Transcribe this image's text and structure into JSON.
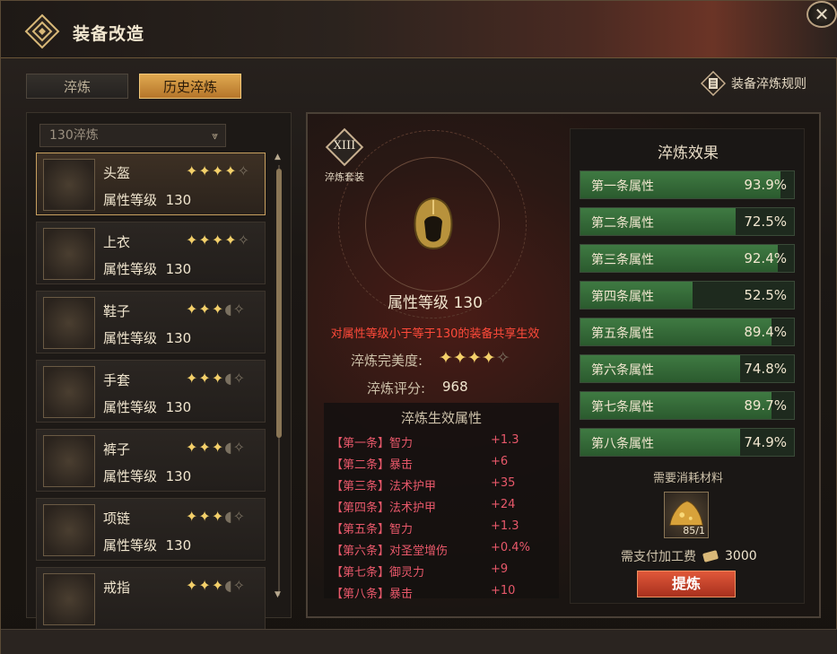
{
  "window": {
    "title": "装备改造"
  },
  "tabs": [
    {
      "label": "淬炼"
    },
    {
      "label": "历史淬炼"
    }
  ],
  "rules_link": {
    "label": "装备淬炼规则"
  },
  "filter": {
    "selected": "130淬炼"
  },
  "equipment_list": [
    {
      "name": "头盔",
      "level_label": "属性等级",
      "level": "130",
      "stars": "✦✦✦✦",
      "stars_dim": "✧",
      "icon": "helmet-icon"
    },
    {
      "name": "上衣",
      "level_label": "属性等级",
      "level": "130",
      "stars": "✦✦✦✦",
      "stars_dim": "✧",
      "icon": "armor-icon"
    },
    {
      "name": "鞋子",
      "level_label": "属性等级",
      "level": "130",
      "stars": "✦✦✦",
      "stars_dim": "◖✧",
      "icon": "boots-icon"
    },
    {
      "name": "手套",
      "level_label": "属性等级",
      "level": "130",
      "stars": "✦✦✦",
      "stars_dim": "◖✧",
      "icon": "gloves-icon"
    },
    {
      "name": "裤子",
      "level_label": "属性等级",
      "level": "130",
      "stars": "✦✦✦",
      "stars_dim": "◖✧",
      "icon": "pants-icon"
    },
    {
      "name": "项链",
      "level_label": "属性等级",
      "level": "130",
      "stars": "✦✦✦",
      "stars_dim": "◖✧",
      "icon": "necklace-icon"
    },
    {
      "name": "戒指",
      "level_label": "",
      "level": "",
      "stars": "✦✦✦",
      "stars_dim": "◖✧",
      "icon": "ring-icon"
    }
  ],
  "detail": {
    "set_number": "XIII",
    "set_label": "淬炼套装",
    "attr_level": "属性等级  130",
    "share_note": "对属性等级小于等于130的装备共享生效",
    "perfect_label": "淬炼完美度:",
    "perfect_stars": "✦✦✦✦",
    "perfect_stars_dim": "✧",
    "score_label": "淬炼评分:",
    "score_value": "968",
    "effect_title": "淬炼生效属性",
    "effects": [
      {
        "label": "【第一条】智力",
        "value": "+1.3"
      },
      {
        "label": "【第二条】暴击",
        "value": "+6"
      },
      {
        "label": "【第三条】法术护甲",
        "value": "+35"
      },
      {
        "label": "【第四条】法术护甲",
        "value": "+24"
      },
      {
        "label": "【第五条】智力",
        "value": "+1.3"
      },
      {
        "label": "【第六条】对圣堂增伤",
        "value": "+0.4%"
      },
      {
        "label": "【第七条】御灵力",
        "value": "+9"
      },
      {
        "label": "【第八条】暴击",
        "value": "+10"
      }
    ]
  },
  "refine_effects": {
    "title": "淬炼效果",
    "bars": [
      {
        "name": "第一条属性",
        "pct_label": "93.9%",
        "pct": 93.9
      },
      {
        "name": "第二条属性",
        "pct_label": "72.5%",
        "pct": 72.5
      },
      {
        "name": "第三条属性",
        "pct_label": "92.4%",
        "pct": 92.4
      },
      {
        "name": "第四条属性",
        "pct_label": "52.5%",
        "pct": 52.5
      },
      {
        "name": "第五条属性",
        "pct_label": "89.4%",
        "pct": 89.4
      },
      {
        "name": "第六条属性",
        "pct_label": "74.8%",
        "pct": 74.8
      },
      {
        "name": "第七条属性",
        "pct_label": "89.7%",
        "pct": 89.7
      },
      {
        "name": "第八条属性",
        "pct_label": "74.9%",
        "pct": 74.9
      }
    ],
    "material_label": "需要消耗材料",
    "material_count": "85/1",
    "fee_label": "需支付加工费",
    "fee_value": "3000",
    "button_label": "提炼"
  }
}
